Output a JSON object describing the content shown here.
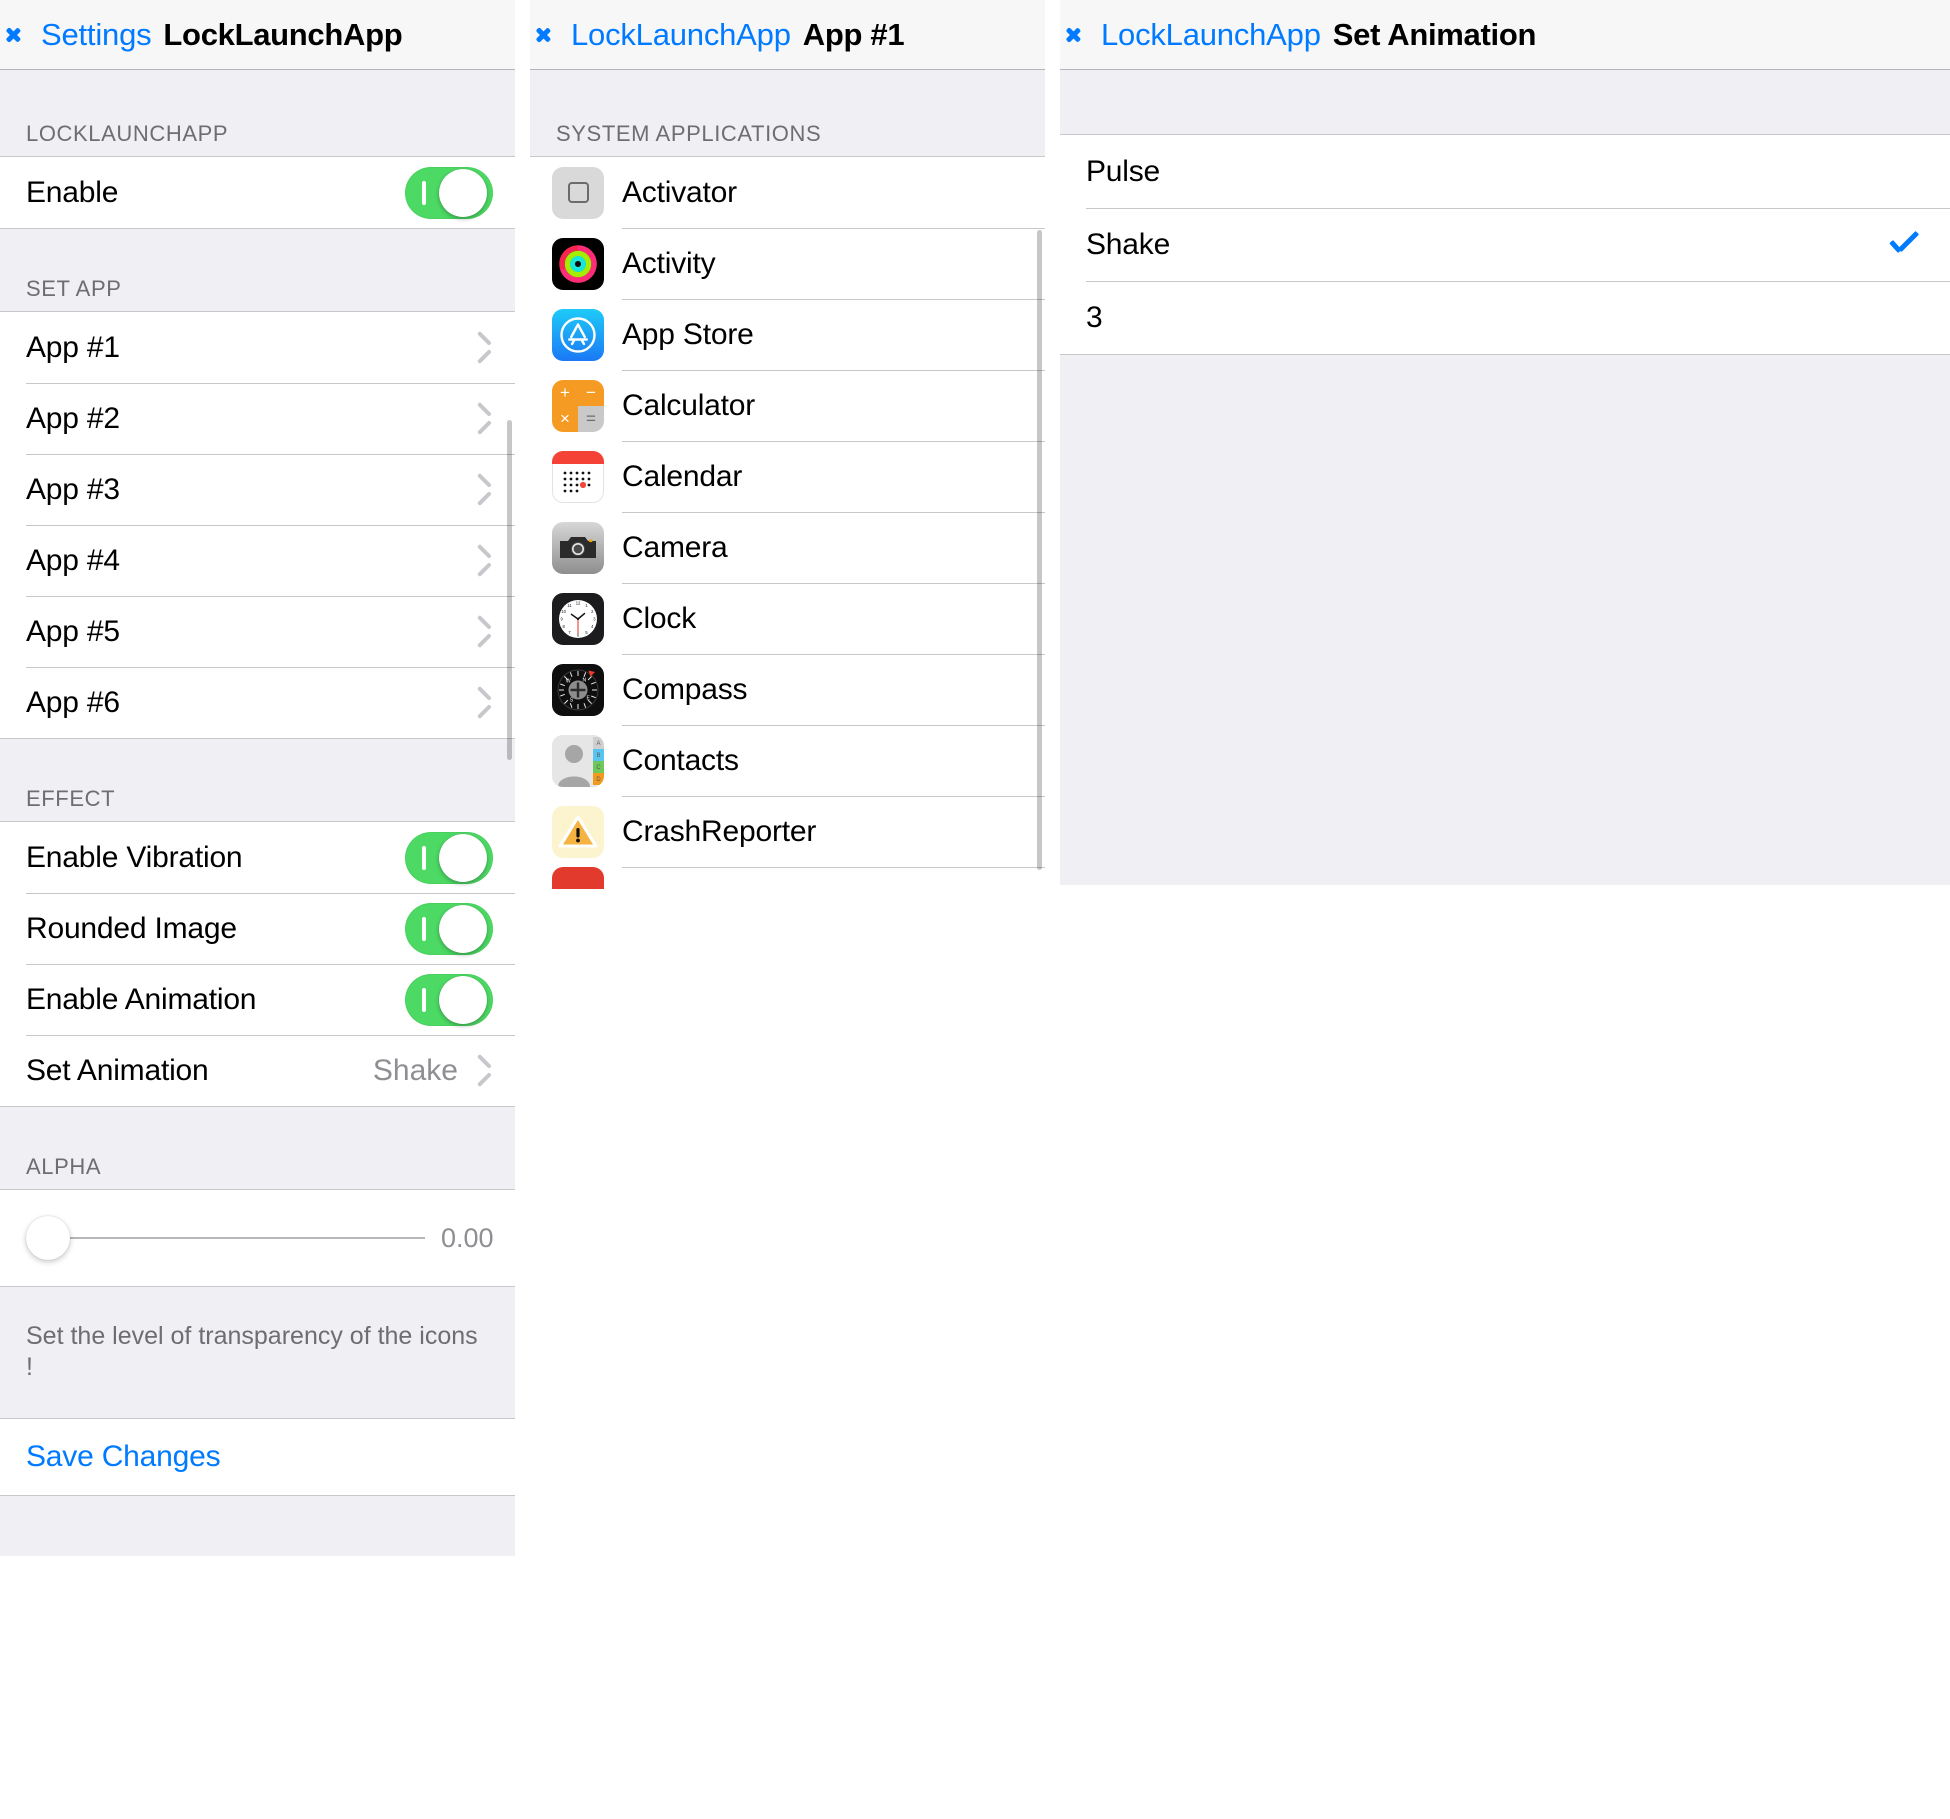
{
  "left_panel": {
    "nav": {
      "back_label": "Settings",
      "title": "LockLaunchApp"
    },
    "section_locklaunchapp": {
      "header": "LOCKLAUNCHAPP",
      "rows": [
        {
          "label": "Enable",
          "type": "switch",
          "value": "on"
        }
      ]
    },
    "section_setapp": {
      "header": "SET APP",
      "rows": [
        {
          "label": "App #1"
        },
        {
          "label": "App #2"
        },
        {
          "label": "App #3"
        },
        {
          "label": "App #4"
        },
        {
          "label": "App #5"
        },
        {
          "label": "App #6"
        }
      ]
    },
    "section_effect": {
      "header": "EFFECT",
      "rows": [
        {
          "label": "Enable Vibration",
          "type": "switch",
          "value": "on"
        },
        {
          "label": "Rounded Image",
          "type": "switch",
          "value": "on"
        },
        {
          "label": "Enable Animation",
          "type": "switch",
          "value": "on"
        },
        {
          "label": "Set Animation",
          "type": "disclosure",
          "value": "Shake"
        }
      ]
    },
    "section_alpha": {
      "header": "ALPHA",
      "slider_value": "0.00",
      "slider_position_pct": 0,
      "footer": "Set the level of transparency of the icons !"
    },
    "save": {
      "label": "Save Changes"
    }
  },
  "middle_panel": {
    "nav": {
      "back_label": "LockLaunchApp",
      "title": "App #1"
    },
    "section": {
      "header": "SYSTEM APPLICATIONS",
      "apps": [
        {
          "name": "Activator",
          "icon": "activator-icon"
        },
        {
          "name": "Activity",
          "icon": "activity-icon"
        },
        {
          "name": "App Store",
          "icon": "app-store-icon"
        },
        {
          "name": "Calculator",
          "icon": "calculator-icon"
        },
        {
          "name": "Calendar",
          "icon": "calendar-icon"
        },
        {
          "name": "Camera",
          "icon": "camera-icon"
        },
        {
          "name": "Clock",
          "icon": "clock-icon"
        },
        {
          "name": "Compass",
          "icon": "compass-icon"
        },
        {
          "name": "Contacts",
          "icon": "contacts-icon"
        },
        {
          "name": "CrashReporter",
          "icon": "crash-reporter-icon"
        }
      ]
    },
    "calculator_keys": {
      "plus": "+",
      "minus": "−",
      "times": "×",
      "equals": "="
    },
    "compass_marks": {
      "n": "N",
      "e": "E",
      "s": "S",
      "w": "W"
    },
    "contacts_tabs": [
      "A",
      "B",
      "C",
      "D"
    ],
    "crash_glyph": "!"
  },
  "right_panel": {
    "nav": {
      "back_label": "LockLaunchApp",
      "title": "Set Animation"
    },
    "options": [
      {
        "label": "Pulse",
        "selected": false
      },
      {
        "label": "Shake",
        "selected": true
      },
      {
        "label": "3",
        "selected": false
      }
    ]
  },
  "colors": {
    "tint_blue": "#007aff",
    "switch_green": "#4cd964",
    "group_bg": "#efeff4",
    "separator": "#c8c7cc",
    "secondary_text": "#8e8e93"
  }
}
